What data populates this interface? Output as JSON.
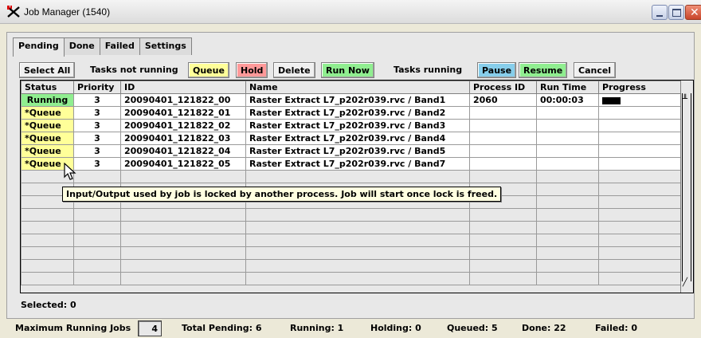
{
  "window": {
    "title": "Job Manager (1540)"
  },
  "tabs": [
    {
      "label": "Pending",
      "active": true
    },
    {
      "label": "Done",
      "active": false
    },
    {
      "label": "Failed",
      "active": false
    },
    {
      "label": "Settings",
      "active": false
    }
  ],
  "toolbar": {
    "select_all": "Select All",
    "tasks_not_running": "Tasks not running",
    "queue": "Queue",
    "hold": "Hold",
    "delete": "Delete",
    "run_now": "Run Now",
    "tasks_running": "Tasks running",
    "pause": "Pause",
    "resume": "Resume",
    "cancel": "Cancel"
  },
  "colors": {
    "queue": "#ffff99",
    "hold": "#ff9999",
    "run_now": "#90ee90",
    "pause": "#87ceeb",
    "resume": "#90ee90",
    "running": "#90ee90"
  },
  "table": {
    "columns": [
      "Status",
      "Priority",
      "ID",
      "Name",
      "Process ID",
      "Run Time",
      "Progress"
    ],
    "rows": [
      {
        "status": "Running",
        "priority": "3",
        "id": "20090401_121822_00",
        "name": "Raster Extract L7_p202r039.rvc / Band1",
        "process_id": "2060",
        "run_time": "00:00:03",
        "progress": 0.25
      },
      {
        "status": "*Queue",
        "priority": "3",
        "id": "20090401_121822_01",
        "name": "Raster Extract L7_p202r039.rvc / Band2",
        "process_id": "",
        "run_time": "",
        "progress": null
      },
      {
        "status": "*Queue",
        "priority": "3",
        "id": "20090401_121822_02",
        "name": "Raster Extract L7_p202r039.rvc / Band3",
        "process_id": "",
        "run_time": "",
        "progress": null
      },
      {
        "status": "*Queue",
        "priority": "3",
        "id": "20090401_121822_03",
        "name": "Raster Extract L7_p202r039.rvc / Band4",
        "process_id": "",
        "run_time": "",
        "progress": null
      },
      {
        "status": "*Queue",
        "priority": "3",
        "id": "20090401_121822_04",
        "name": "Raster Extract L7_p202r039.rvc / Band5",
        "process_id": "",
        "run_time": "",
        "progress": null
      },
      {
        "status": "*Queue",
        "priority": "3",
        "id": "20090401_121822_05",
        "name": "Raster Extract L7_p202r039.rvc / Band7",
        "process_id": "",
        "run_time": "",
        "progress": null
      }
    ],
    "empty_rows": 9
  },
  "tooltip": "Input/Output used by job is locked by another process.  Job will start once lock is freed.",
  "selected": "Selected: 0",
  "footer": {
    "max_running_label": "Maximum Running Jobs",
    "max_running_value": "4",
    "total_pending": "Total Pending: 6",
    "running": "Running: 1",
    "holding": "Holding: 0",
    "queued": "Queued: 5",
    "done": "Done: 22",
    "failed": "Failed: 0"
  }
}
